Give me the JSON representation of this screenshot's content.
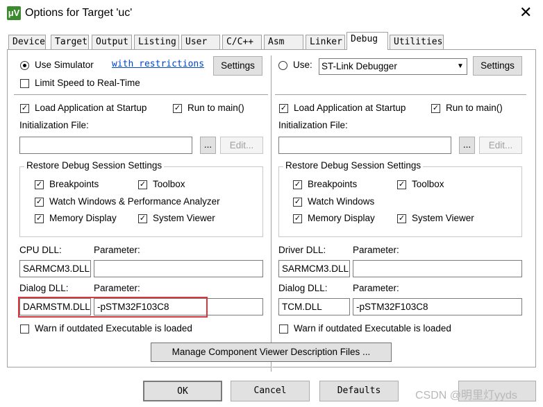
{
  "window": {
    "title": "Options for Target 'uc'",
    "app_icon_text": "μV",
    "close_glyph": "✕"
  },
  "tabs": [
    {
      "label": "Device",
      "active": false
    },
    {
      "label": "Target",
      "active": false
    },
    {
      "label": "Output",
      "active": false
    },
    {
      "label": "Listing",
      "active": false
    },
    {
      "label": "User",
      "active": false
    },
    {
      "label": "C/C++",
      "active": false
    },
    {
      "label": "Asm",
      "active": false
    },
    {
      "label": "Linker",
      "active": false
    },
    {
      "label": "Debug",
      "active": true
    },
    {
      "label": "Utilities",
      "active": false
    }
  ],
  "left": {
    "use_simulator_label": "Use Simulator",
    "use_simulator_selected": true,
    "with_restrictions_link": "with restrictions",
    "settings_label": "Settings",
    "limit_speed_label": "Limit Speed to Real-Time",
    "limit_speed_checked": false,
    "load_app_label": "Load Application at Startup",
    "run_to_main_label": "Run to main()",
    "init_file_label": "Initialization File:",
    "init_file_value": "",
    "browse_label": "...",
    "edit_label": "Edit...",
    "restore_group_title": "Restore Debug Session Settings",
    "breakpoints_label": "Breakpoints",
    "toolbox_label": "Toolbox",
    "watch_label": "Watch Windows & Performance Analyzer",
    "memory_label": "Memory Display",
    "sysviewer_label": "System Viewer",
    "cpu_dll_label": "CPU DLL:",
    "cpu_param_label": "Parameter:",
    "cpu_dll_value": "SARMCM3.DLL",
    "cpu_param_value": "",
    "dialog_dll_label": "Dialog DLL:",
    "dialog_param_label": "Parameter:",
    "dialog_dll_value": "DARMSTM.DLL",
    "dialog_param_value": "-pSTM32F103C8",
    "warn_label": "Warn if outdated Executable is loaded"
  },
  "right": {
    "use_label": "Use:",
    "use_selected": false,
    "debugger_value": "ST-Link Debugger",
    "settings_label": "Settings",
    "load_app_label": "Load Application at Startup",
    "run_to_main_label": "Run to main()",
    "init_file_label": "Initialization File:",
    "init_file_value": "",
    "browse_label": "...",
    "edit_label": "Edit...",
    "restore_group_title": "Restore Debug Session Settings",
    "breakpoints_label": "Breakpoints",
    "toolbox_label": "Toolbox",
    "watch_label": "Watch Windows",
    "memory_label": "Memory Display",
    "sysviewer_label": "System Viewer",
    "driver_dll_label": "Driver DLL:",
    "driver_param_label": "Parameter:",
    "driver_dll_value": "SARMCM3.DLL",
    "driver_param_value": "",
    "dialog_dll_label": "Dialog DLL:",
    "dialog_param_label": "Parameter:",
    "dialog_dll_value": "TCM.DLL",
    "dialog_param_value": "-pSTM32F103C8",
    "warn_label": "Warn if outdated Executable is loaded"
  },
  "manage_button_label": "Manage Component Viewer Description Files ...",
  "footer": {
    "ok_label": "OK",
    "cancel_label": "Cancel",
    "defaults_label": "Defaults",
    "watermark": "CSDN @明里灯yyds"
  },
  "check_glyph": "✓",
  "colors": {
    "highlight": "#d9363e",
    "link": "#0044cc",
    "app_icon": "#3b8a2e"
  }
}
